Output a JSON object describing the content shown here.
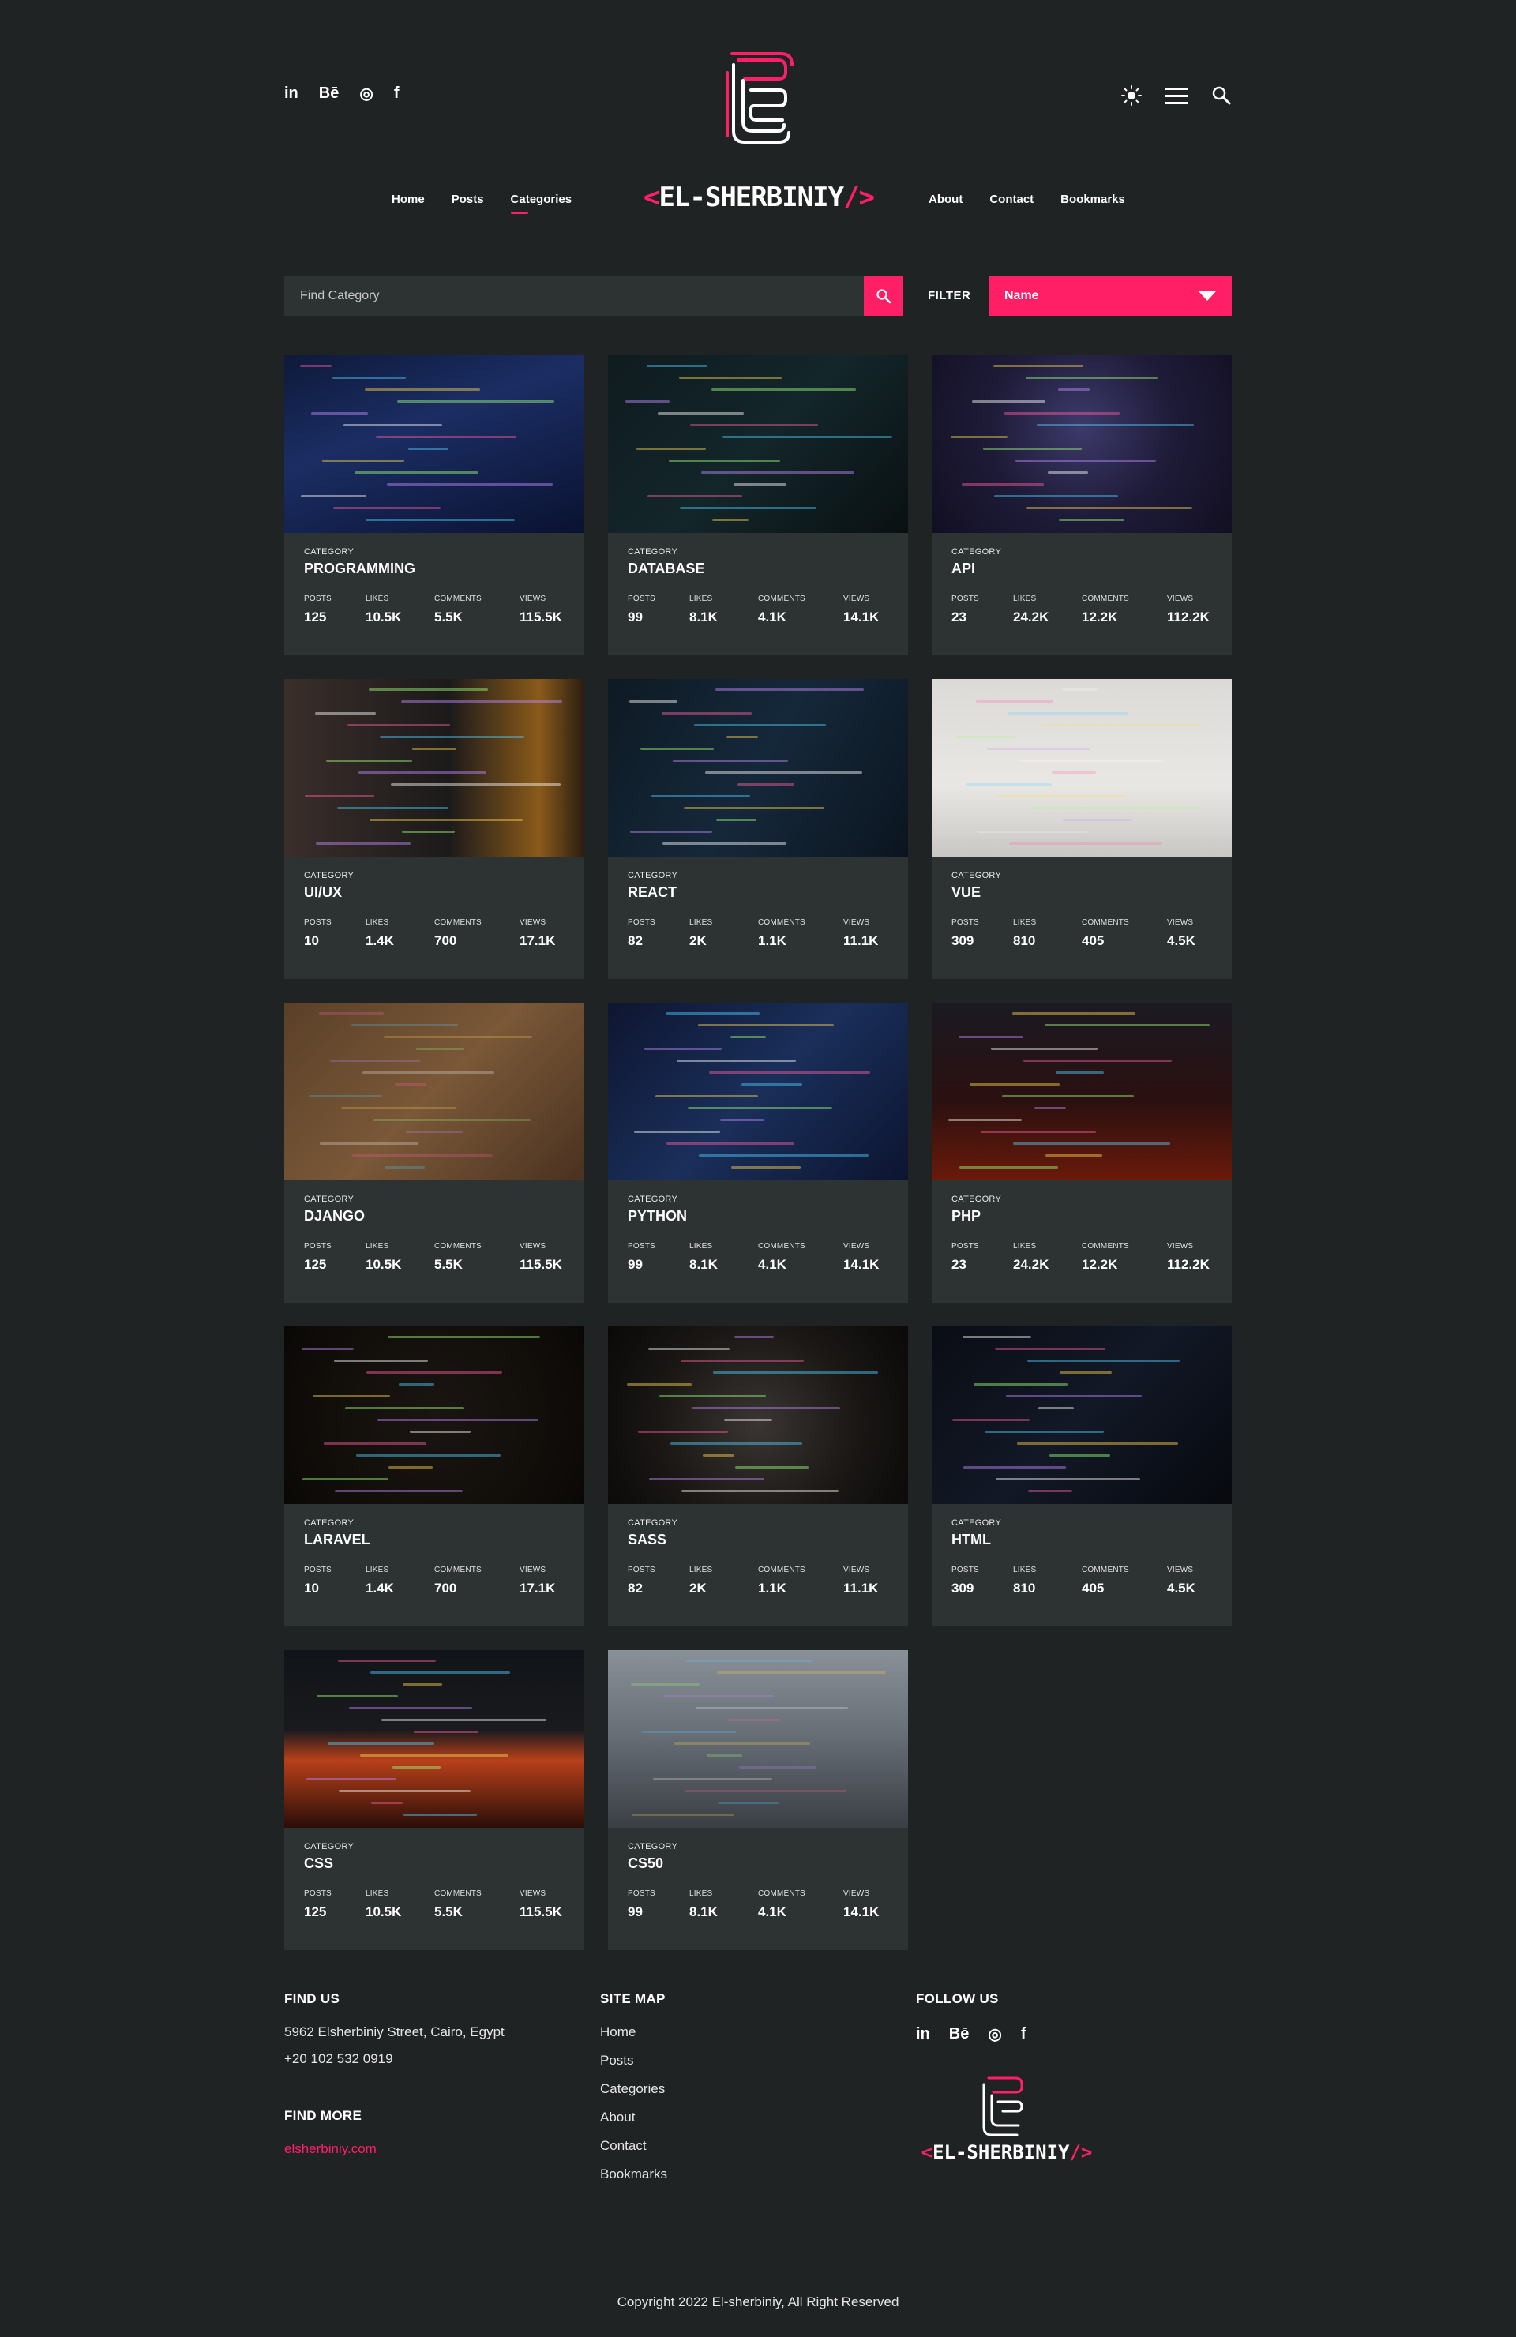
{
  "social": [
    "in",
    "Bē",
    "◎",
    "f"
  ],
  "nav": {
    "left": [
      "Home",
      "Posts",
      "Categories"
    ],
    "right": [
      "About",
      "Contact",
      "Bookmarks"
    ],
    "active": "Categories"
  },
  "brand": {
    "open": "<",
    "name": "EL-SHERBINIY",
    "close": "/>"
  },
  "search": {
    "placeholder": "Find Category"
  },
  "filter": {
    "label": "FILTER",
    "selected": "Name"
  },
  "stat_labels": {
    "posts": "POSTS",
    "likes": "LIKES",
    "comments": "COMMENTS",
    "views": "VIEWS",
    "category": "CATEGORY"
  },
  "cards": [
    {
      "name": "PROGRAMMING",
      "posts": "125",
      "likes": "10.5K",
      "comments": "5.5K",
      "views": "115.5K",
      "image": "keyboard"
    },
    {
      "name": "DATABASE",
      "posts": "99",
      "likes": "8.1K",
      "comments": "4.1K",
      "views": "14.1K",
      "image": "code-editor"
    },
    {
      "name": "API",
      "posts": "23",
      "likes": "24.2K",
      "comments": "12.2K",
      "views": "112.2K",
      "image": "monitor-purple"
    },
    {
      "name": "UI/UX",
      "posts": "10",
      "likes": "1.4K",
      "comments": "700",
      "views": "17.1K",
      "image": "laptop-lamp"
    },
    {
      "name": "REACT",
      "posts": "82",
      "likes": "2K",
      "comments": "1.1K",
      "views": "11.1K",
      "image": "code-blur"
    },
    {
      "name": "VUE",
      "posts": "309",
      "likes": "810",
      "comments": "405",
      "views": "4.5K",
      "image": "desk-setup"
    },
    {
      "name": "DJANGO",
      "posts": "125",
      "likes": "10.5K",
      "comments": "5.5K",
      "views": "115.5K",
      "image": "laptop-wood"
    },
    {
      "name": "PYTHON",
      "posts": "99",
      "likes": "8.1K",
      "comments": "4.1K",
      "views": "14.1K",
      "image": "code-html"
    },
    {
      "name": "PHP",
      "posts": "23",
      "likes": "24.2K",
      "comments": "12.2K",
      "views": "112.2K",
      "image": "red-keyboard"
    },
    {
      "name": "LARAVEL",
      "posts": "10",
      "likes": "1.4K",
      "comments": "700",
      "views": "17.1K",
      "image": "phone-neon"
    },
    {
      "name": "SASS",
      "posts": "82",
      "likes": "2K",
      "comments": "1.1K",
      "views": "11.1K",
      "image": "triple-monitor"
    },
    {
      "name": "HTML",
      "posts": "309",
      "likes": "810",
      "comments": "405",
      "views": "4.5K",
      "image": "dark-code"
    },
    {
      "name": "CSS",
      "posts": "125",
      "likes": "10.5K",
      "comments": "5.5K",
      "views": "115.5K",
      "image": "red-glow-desk"
    },
    {
      "name": "CS50",
      "posts": "99",
      "likes": "8.1K",
      "comments": "4.1K",
      "views": "14.1K",
      "image": "laptop-plant"
    }
  ],
  "footer": {
    "find_us": {
      "title": "FIND US",
      "address": "5962 Elsherbiniy Street, Cairo, Egypt",
      "phone": "+20 102 532 0919"
    },
    "find_more": {
      "title": "FIND MORE",
      "link": "elsherbiniy.com"
    },
    "site_map": {
      "title": "SITE MAP",
      "links": [
        "Home",
        "Posts",
        "Categories",
        "About",
        "Contact",
        "Bookmarks"
      ]
    },
    "follow_us": {
      "title": "FOLLOW US"
    },
    "copyright": "Copyright 2022 El-sherbiniy, All Right Reserved"
  },
  "colors": {
    "accent": "#ff1f66",
    "bg": "#1f2324",
    "card": "#2d3233"
  }
}
